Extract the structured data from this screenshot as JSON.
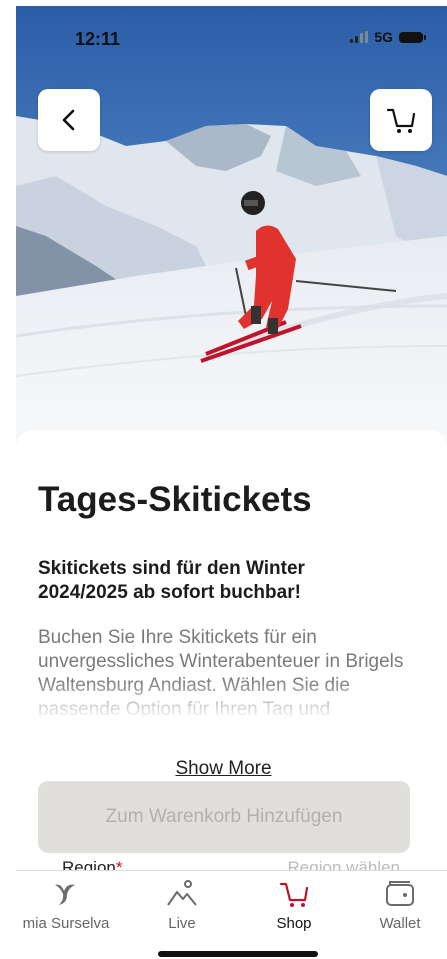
{
  "status_bar": {
    "time": "12:11",
    "network": "5G"
  },
  "header": {
    "back_icon": "chevron-left-icon",
    "cart_icon": "shopping-cart-icon"
  },
  "content": {
    "title": "Tages-Skitickets",
    "subtitle": "Skitickets sind für den Winter 2024/2025 ab sofort buchbar!",
    "description": "Buchen Sie Ihre Skitickets für ein unvergessliches Winterabenteuer in Brigels Waltensburg Andiast. Wählen Sie die passende Option für Ihren Tag und",
    "show_more_label": "Show More",
    "add_to_cart_label": "Zum Warenkorb Hinzufügen",
    "region_label": "Region",
    "region_required_mark": "*",
    "region_placeholder": "Region wählen"
  },
  "tabbar": {
    "items": [
      {
        "label": "mia Surselva",
        "icon": "surselva-logo-icon"
      },
      {
        "label": "Live",
        "icon": "mountain-icon"
      },
      {
        "label": "Shop",
        "icon": "shopping-cart-icon"
      },
      {
        "label": "Wallet",
        "icon": "wallet-icon"
      }
    ],
    "active": "Shop",
    "accent_color": "#c0122a"
  }
}
